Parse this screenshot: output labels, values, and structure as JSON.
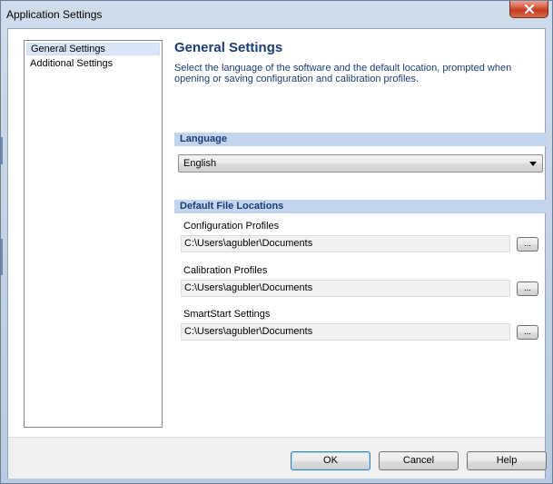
{
  "window": {
    "title": "Application Settings",
    "close_glyph": "x"
  },
  "nav": {
    "items": [
      {
        "label": "General Settings",
        "selected": true
      },
      {
        "label": "Additional Settings",
        "selected": false
      }
    ]
  },
  "content": {
    "heading": "General Settings",
    "description": "Select the language of the software and the default location, prompted when opening or saving configuration and calibration profiles."
  },
  "language": {
    "section_title": "Language",
    "selected": "English"
  },
  "file_locations": {
    "section_title": "Default File Locations",
    "fields": [
      {
        "label": "Configuration Profiles",
        "value": "C:\\Users\\agubler\\Documents",
        "browse_label": "..."
      },
      {
        "label": "Calibration Profiles",
        "value": "C:\\Users\\agubler\\Documents",
        "browse_label": "..."
      },
      {
        "label": "SmartStart Settings",
        "value": "C:\\Users\\agubler\\Documents",
        "browse_label": "..."
      }
    ]
  },
  "footer": {
    "ok_label": "OK",
    "cancel_label": "Cancel",
    "help_label": "Help"
  },
  "colors": {
    "heading": "#1c3c78",
    "section_band": "#c3d5ec",
    "close_button": "#c33b1e"
  }
}
